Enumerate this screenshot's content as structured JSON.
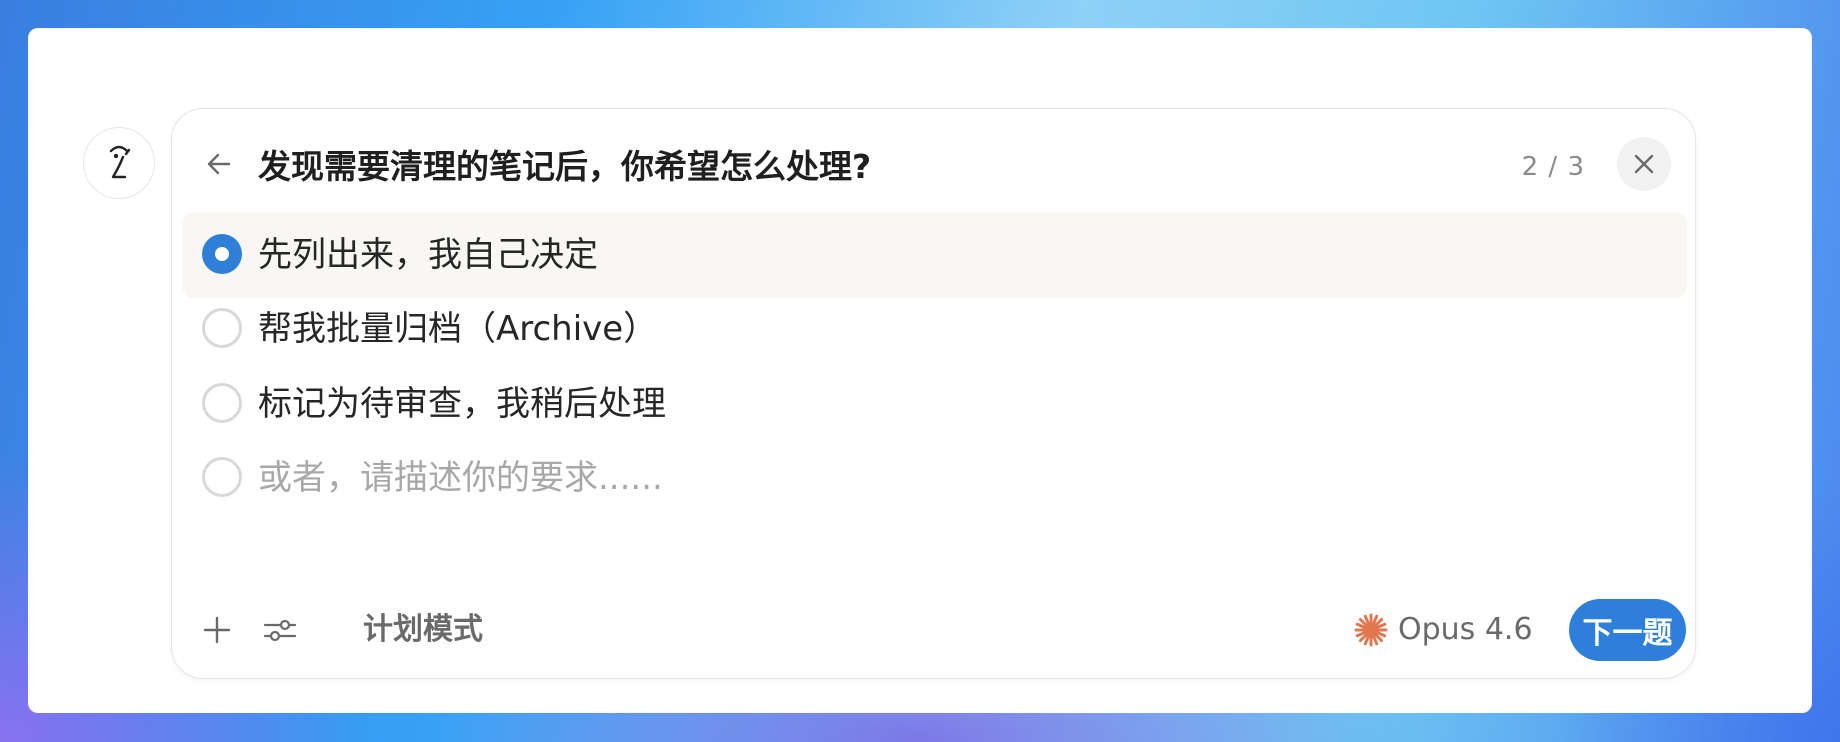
{
  "question": {
    "title": "发现需要清理的笔记后，你希望怎么处理?",
    "counter": "2 / 3"
  },
  "options": [
    {
      "label": "先列出来，我自己决定",
      "selected": true
    },
    {
      "label": "帮我批量归档（Archive）",
      "selected": false
    },
    {
      "label": "标记为待审查，我稍后处理",
      "selected": false
    }
  ],
  "custom_input": {
    "value": "",
    "placeholder": "或者，请描述你的要求......"
  },
  "footer": {
    "mode_label": "计划模式",
    "model_name": "Opus 4.6",
    "next_label": "下一题"
  },
  "colors": {
    "accent": "#2e7fd9",
    "model_icon": "#e0774f",
    "selected_row_bg": "#f8f7f4"
  },
  "icons": {
    "back": "arrow-left-icon",
    "close": "close-icon",
    "add": "plus-icon",
    "settings": "sliders-icon",
    "model": "sparkle-icon",
    "avatar": "assistant-logo-icon"
  }
}
